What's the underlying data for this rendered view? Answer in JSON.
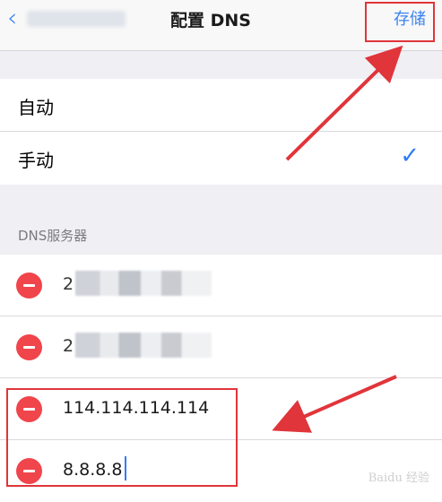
{
  "nav": {
    "title": "配置 DNS",
    "save_label": "存储",
    "back_icon": "chevron-left-icon"
  },
  "modes": [
    {
      "label": "自动",
      "selected": false
    },
    {
      "label": "手动",
      "selected": true
    }
  ],
  "dns_section": {
    "title": "DNS服务器",
    "servers": [
      "2",
      "2",
      "114.114.114.114",
      "8.8.8.8"
    ]
  },
  "watermark": "Baidu 经验",
  "colors": {
    "accent": "#2f7cf6",
    "delete": "#f0454b",
    "highlight": "#e0353a"
  }
}
